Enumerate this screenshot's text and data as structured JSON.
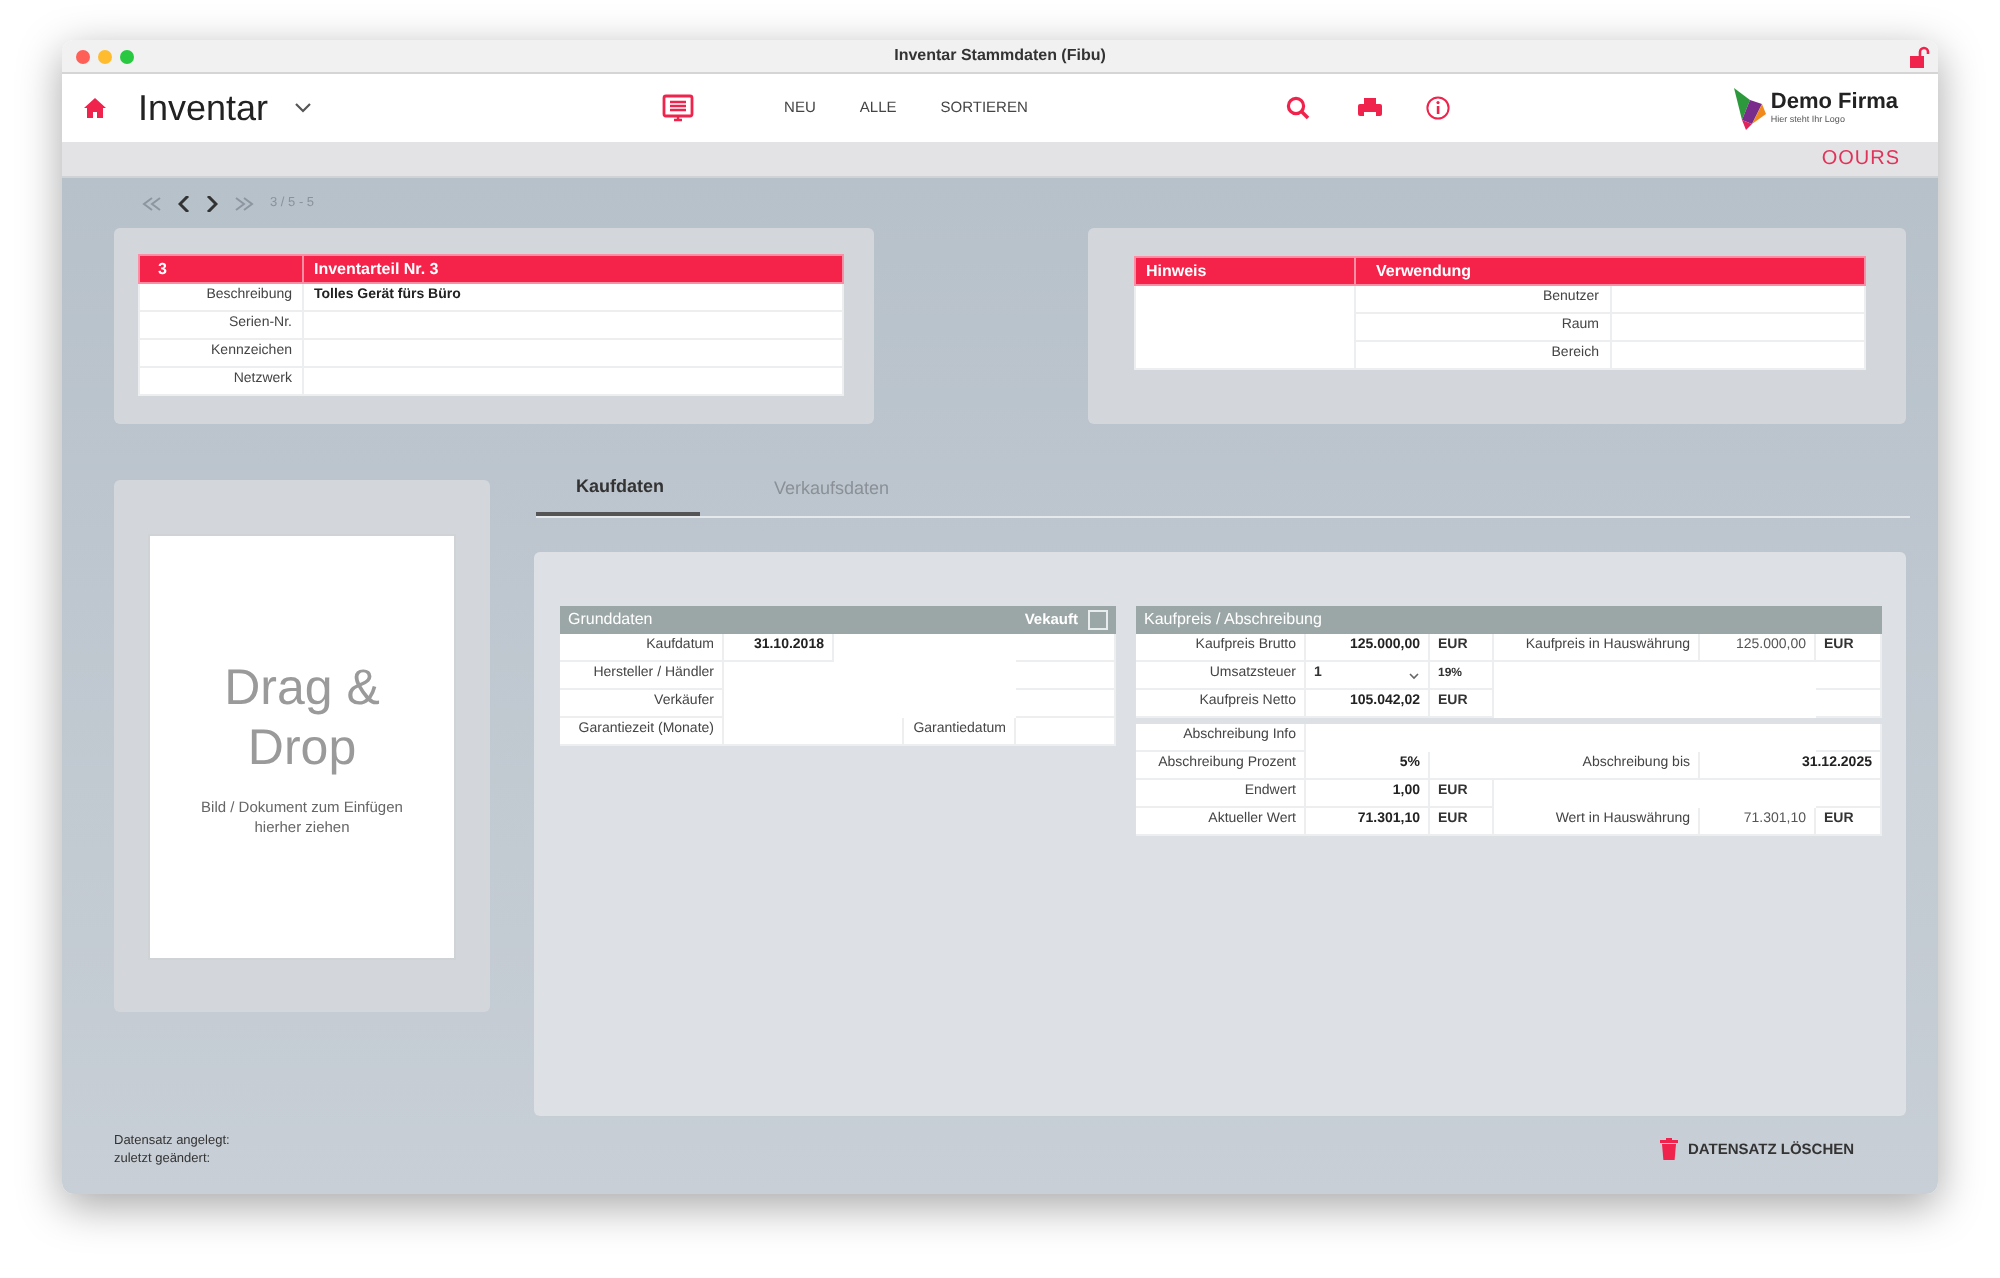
{
  "window": {
    "title": "Inventar Stammdaten (Fibu)",
    "locked": false
  },
  "header": {
    "app_title": "Inventar",
    "nav": [
      "NEU",
      "ALLE",
      "SORTIEREN"
    ],
    "logo_name": "Demo Firma",
    "logo_tagline": "Hier steht Ihr Logo",
    "brand": "OOURS"
  },
  "pager": {
    "position": "3 / 5 - 5"
  },
  "record": {
    "id": "3",
    "title": "Inventarteil Nr. 3",
    "fields": [
      {
        "label": "Beschreibung",
        "value": "Tolles Gerät fürs Büro"
      },
      {
        "label": "Serien-Nr."
      },
      {
        "label": "Kennzeichen"
      },
      {
        "label": "Netzwerk"
      }
    ]
  },
  "usage": {
    "note_title": "Hinweis",
    "title": "Verwendung",
    "fields": [
      {
        "label": "Benutzer"
      },
      {
        "label": "Raum"
      },
      {
        "label": "Bereich"
      }
    ]
  },
  "dropzone": {
    "title": "Drag & Drop",
    "hint": "Bild / Dokument zum Einfügen hierher ziehen"
  },
  "tabs": [
    {
      "label": "Kaufdaten",
      "selected": true
    },
    {
      "label": "Verkaufsdaten",
      "selected": false
    }
  ],
  "grunddaten": {
    "title": "Grunddaten",
    "sold_label": "Vekauft",
    "sold": false,
    "rows": [
      [
        {
          "kind": "label",
          "text": "Kaufdatum"
        },
        {
          "kind": "value",
          "text": "31.10.2018"
        },
        {
          "kind": "blank"
        }
      ],
      [
        {
          "kind": "label",
          "text": "Hersteller / Händler"
        },
        {
          "kind": "blank"
        }
      ],
      [
        {
          "kind": "label",
          "text": "Verkäufer"
        },
        {
          "kind": "blank"
        }
      ],
      [
        {
          "kind": "label",
          "text": "Garantiezeit (Monate)"
        },
        {
          "kind": "field2"
        },
        {
          "kind": "label",
          "text": "Garantiedatum"
        },
        {
          "kind": "blank"
        }
      ]
    ]
  },
  "kaufpreis": {
    "title": "Kaufpreis / Abschreibung",
    "sections": [
      [
        [
          {
            "kind": "label",
            "text": "Kaufpreis Brutto"
          },
          {
            "kind": "value",
            "text": "125.000,00"
          },
          {
            "kind": "unit",
            "text": "EUR"
          },
          {
            "kind": "label",
            "text": "Kaufpreis in Hauswährung"
          },
          {
            "kind": "value-light",
            "text": "125.000,00"
          },
          {
            "kind": "unit",
            "text": "EUR"
          }
        ],
        [
          {
            "kind": "label",
            "text": "Umsatzsteuer"
          },
          {
            "kind": "select",
            "text": "1"
          },
          {
            "kind": "small",
            "text": "19%"
          },
          {
            "kind": "blank"
          }
        ],
        [
          {
            "kind": "label",
            "text": "Kaufpreis Netto"
          },
          {
            "kind": "value",
            "text": "105.042,02"
          },
          {
            "kind": "unit",
            "text": "EUR"
          },
          {
            "kind": "blank"
          }
        ]
      ],
      [
        [
          {
            "kind": "label",
            "text": "Abschreibung Info"
          },
          {
            "kind": "blank"
          }
        ],
        [
          {
            "kind": "label",
            "text": "Abschreibung Prozent"
          },
          {
            "kind": "value",
            "text": "5%"
          },
          {
            "kind": "label-wide",
            "text": "Abschreibung bis"
          },
          {
            "kind": "value-wide",
            "text": "31.12.2025"
          }
        ],
        [
          {
            "kind": "label",
            "text": "Endwert"
          },
          {
            "kind": "value",
            "text": "1,00"
          },
          {
            "kind": "unit",
            "text": "EUR"
          },
          {
            "kind": "blank"
          }
        ],
        [
          {
            "kind": "label",
            "text": "Aktueller Wert"
          },
          {
            "kind": "value",
            "text": "71.301,10"
          },
          {
            "kind": "unit",
            "text": "EUR"
          },
          {
            "kind": "label",
            "text": "Wert in Hauswährung"
          },
          {
            "kind": "value-light",
            "text": "71.301,10"
          },
          {
            "kind": "unit",
            "text": "EUR"
          }
        ]
      ]
    ]
  },
  "footer": {
    "created": "Datensatz angelegt:",
    "changed": "zuletzt geändert:",
    "delete": "DATENSATZ LÖSCHEN"
  }
}
